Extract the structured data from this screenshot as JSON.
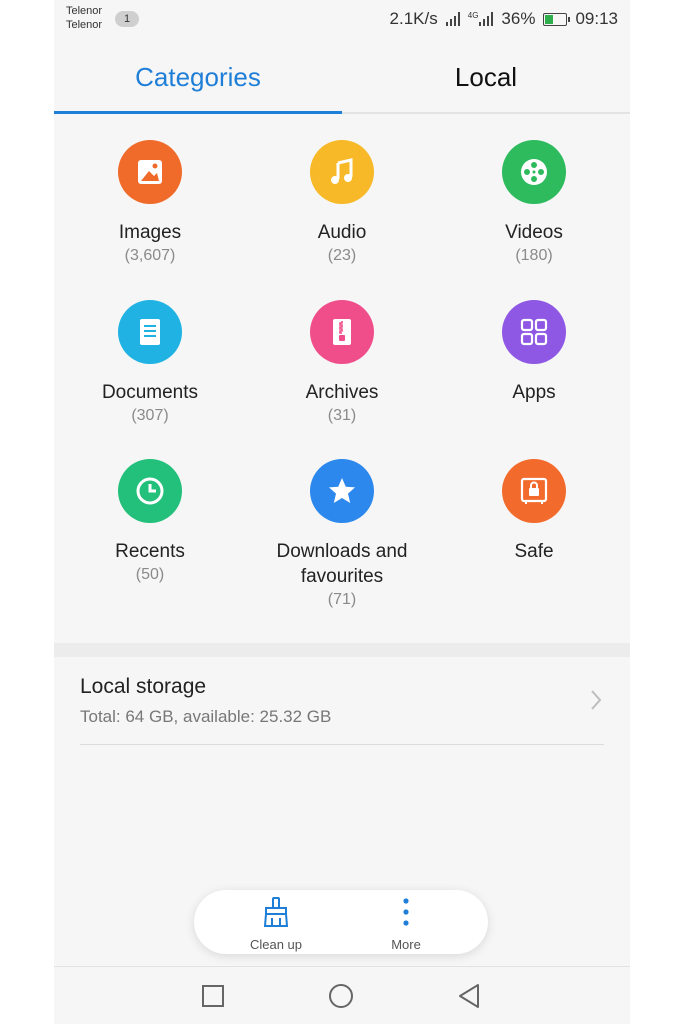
{
  "status_bar": {
    "carrier_1": "Telenor",
    "carrier_2": "Telenor",
    "sim_badge": "1",
    "speed": "2.1K/s",
    "network": "4G",
    "battery": "36%",
    "time": "09:13"
  },
  "tabs": [
    {
      "label": "Categories",
      "active": true
    },
    {
      "label": "Local",
      "active": false
    }
  ],
  "categories": [
    {
      "name": "Images",
      "count": "(3,607)",
      "icon": "image-icon",
      "color": "#f06a2a"
    },
    {
      "name": "Audio",
      "count": "(23)",
      "icon": "music-note-icon",
      "color": "#f7b928"
    },
    {
      "name": "Videos",
      "count": "(180)",
      "icon": "film-reel-icon",
      "color": "#2dbb5d"
    },
    {
      "name": "Documents",
      "count": "(307)",
      "icon": "document-icon",
      "color": "#1fb2e3"
    },
    {
      "name": "Archives",
      "count": "(31)",
      "icon": "archive-zip-icon",
      "color": "#f04e8a"
    },
    {
      "name": "Apps",
      "count": "",
      "icon": "apps-grid-icon",
      "color": "#8e57e4"
    },
    {
      "name": "Recents",
      "count": "(50)",
      "icon": "clock-icon",
      "color": "#22c07a"
    },
    {
      "name": "Downloads and\nfavourites",
      "count": "(71)",
      "icon": "star-icon",
      "color": "#2c88ec"
    },
    {
      "name": "Safe",
      "count": "",
      "icon": "safe-lock-icon",
      "color": "#f26a2c"
    }
  ],
  "local_storage": {
    "title": "Local storage",
    "details": "Total: 64 GB, available: 25.32 GB"
  },
  "actions": {
    "clean_up": "Clean up",
    "more": "More"
  },
  "colors": {
    "accent": "#1f7fd8"
  }
}
